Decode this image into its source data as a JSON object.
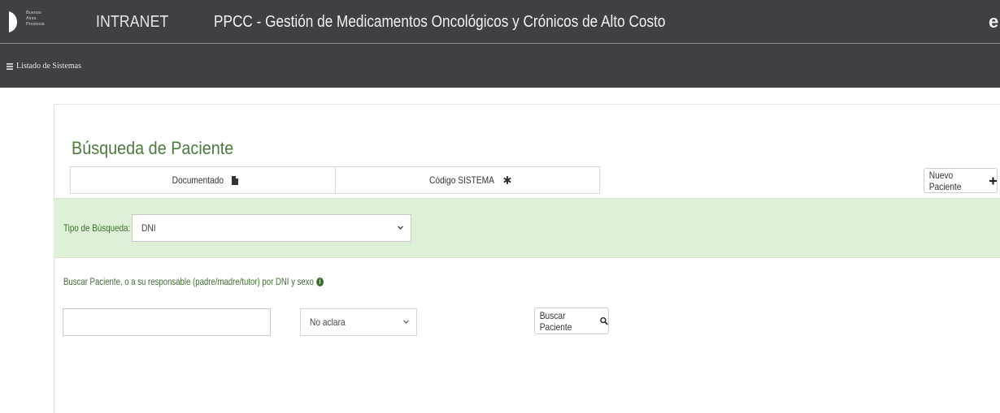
{
  "header": {
    "logo_text": [
      "Buenos",
      "Aires",
      "Provincia"
    ],
    "intranet_label": "INTRANET",
    "app_title": "PPCC - Gestión de Medicamentos Oncológicos y Crónicos de Alto Costo",
    "top_right_glyph": "e"
  },
  "nav": {
    "systems_list_label": "Listado de Sistemas"
  },
  "search_section": {
    "title": "Búsqueda de Paciente",
    "tabs": [
      {
        "label": "Documentado",
        "icon": "file-icon"
      },
      {
        "label": "Código SISTEMA",
        "icon": "asterisk-icon"
      }
    ],
    "new_patient_button": {
      "label": "Nuevo Paciente",
      "icon": "plus-icon"
    },
    "search_type": {
      "label": "Tipo de Búsqueda:",
      "selected": "DNI"
    },
    "search_hint": "Buscar Paciente, o a su responsable (padre/madre/tutor) por DNI y sexo",
    "dni_input": {
      "value": "",
      "placeholder": ""
    },
    "sex_select": {
      "selected": "No aclara"
    },
    "search_button": {
      "label": "Buscar Paciente",
      "icon": "search-icon"
    }
  },
  "colors": {
    "header_bg": "#3e4044",
    "accent_green": "#4a7c3b",
    "band_green": "#dff0d8"
  }
}
